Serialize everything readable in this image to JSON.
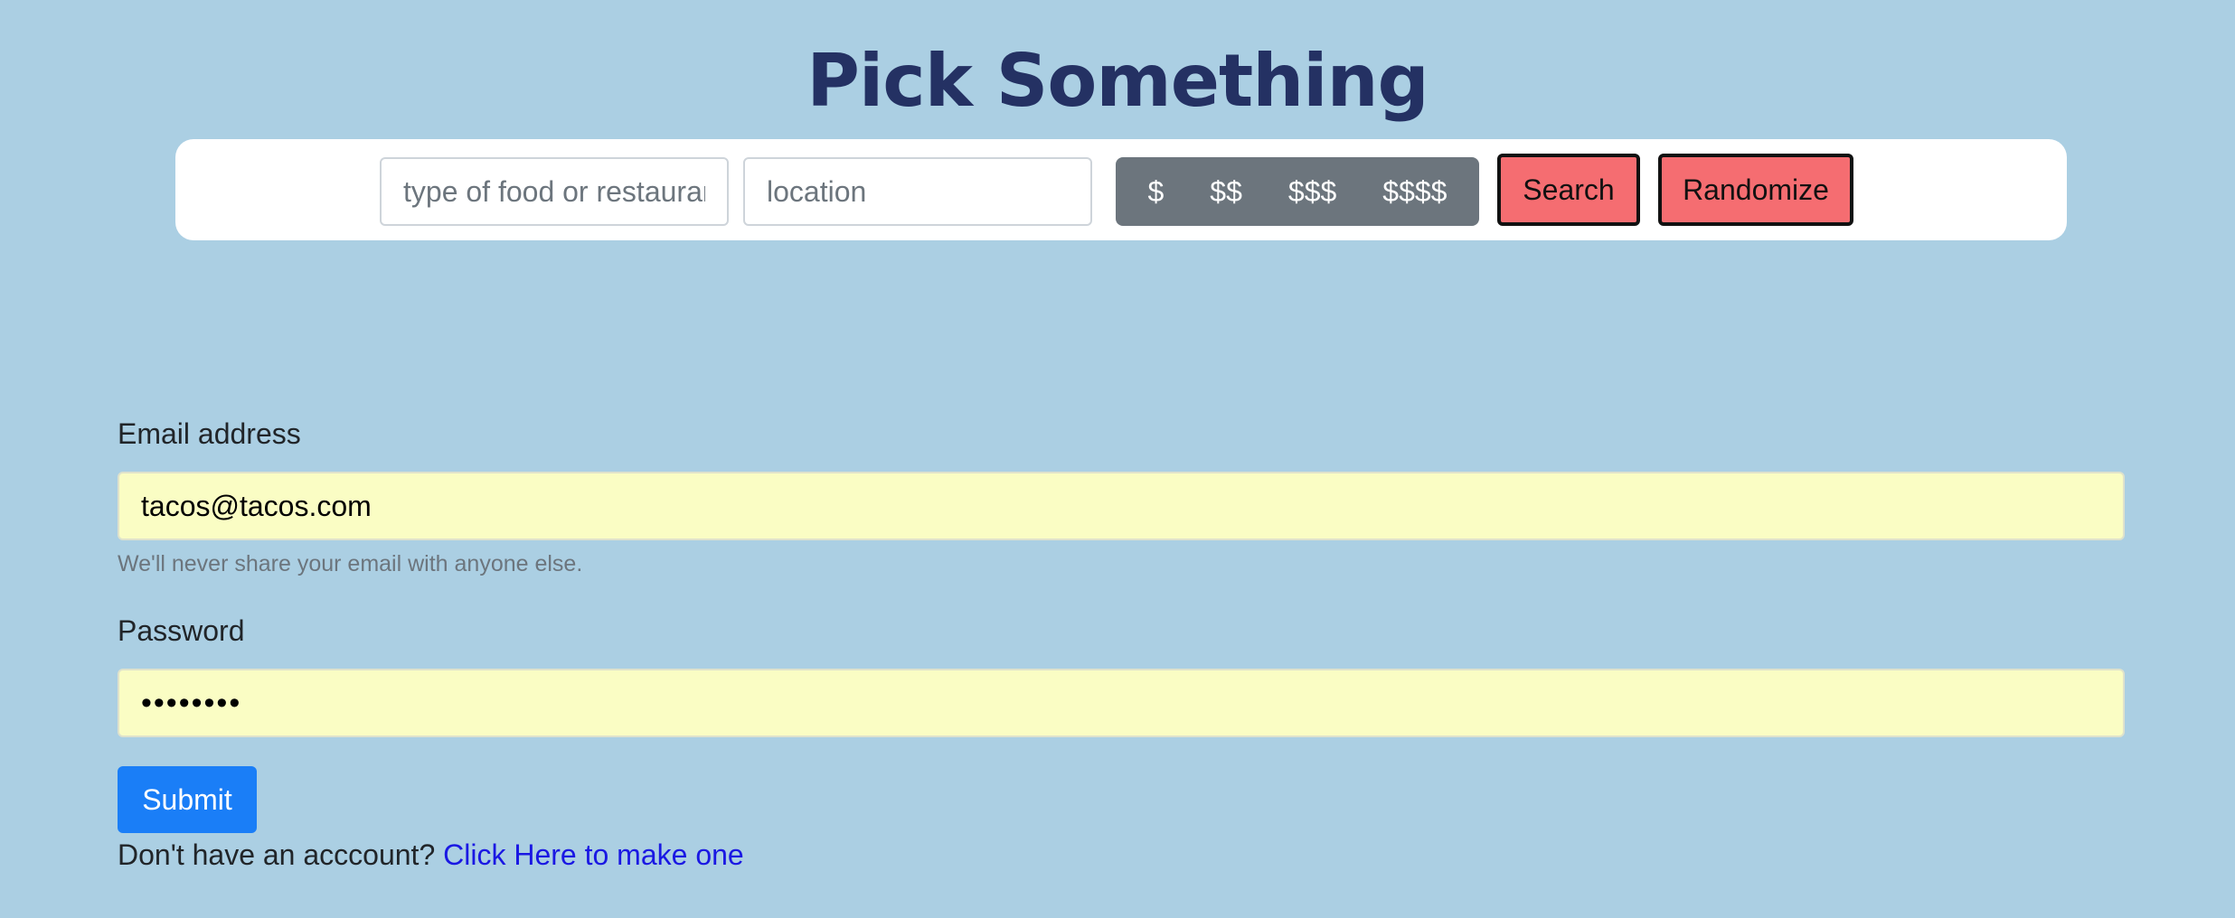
{
  "header": {
    "title": "Pick Something"
  },
  "search": {
    "food_placeholder": "type of food or restaurant",
    "location_placeholder": "location",
    "price_options": [
      "$",
      "$$",
      "$$$",
      "$$$$"
    ],
    "search_label": "Search",
    "randomize_label": "Randomize"
  },
  "form": {
    "email_label": "Email address",
    "email_value": "tacos@tacos.com",
    "email_help": "We'll never share your email with anyone else.",
    "password_label": "Password",
    "password_value": "••••••••",
    "submit_label": "Submit",
    "signup_prompt": "Don't have an acccount?",
    "signup_link": "Click Here to make one"
  },
  "colors": {
    "background": "#abcfe3",
    "title": "#243163",
    "action_button": "#f56d71",
    "price_group": "#6c757d",
    "autofill": "#fafdc4",
    "primary": "#1a7ef7",
    "link": "#1a18e3"
  }
}
